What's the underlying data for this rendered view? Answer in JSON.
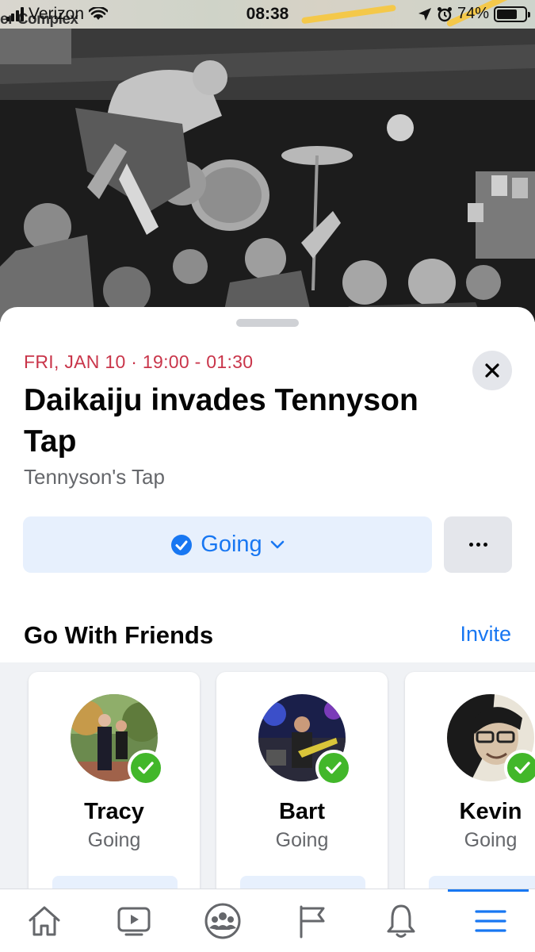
{
  "status_bar": {
    "carrier": "Verizon",
    "background_map_text": "er Complex",
    "time": "08:38",
    "battery_percent": "74%",
    "battery_level": 0.74
  },
  "event": {
    "date_time": "FRI, JAN 10 · 19:00 - 01:30",
    "title": "Daikaiju invades Tennyson Tap",
    "venue": "Tennyson's Tap",
    "rsvp_label": "Going"
  },
  "friends_section": {
    "title": "Go With Friends",
    "invite_label": "Invite",
    "friends": [
      {
        "name": "Tracy",
        "status": "Going"
      },
      {
        "name": "Bart",
        "status": "Going"
      },
      {
        "name": "Kevin",
        "status": "Going"
      }
    ]
  },
  "tab_bar": {
    "tabs": [
      {
        "name": "home-icon"
      },
      {
        "name": "video-icon"
      },
      {
        "name": "groups-icon"
      },
      {
        "name": "pages-flag-icon"
      },
      {
        "name": "notifications-bell-icon"
      },
      {
        "name": "menu-icon",
        "active": true
      }
    ]
  },
  "colors": {
    "accent": "#1877f2",
    "date_red": "#c9354a",
    "going_bg": "#e7f0fd",
    "check_green": "#42b72a"
  }
}
